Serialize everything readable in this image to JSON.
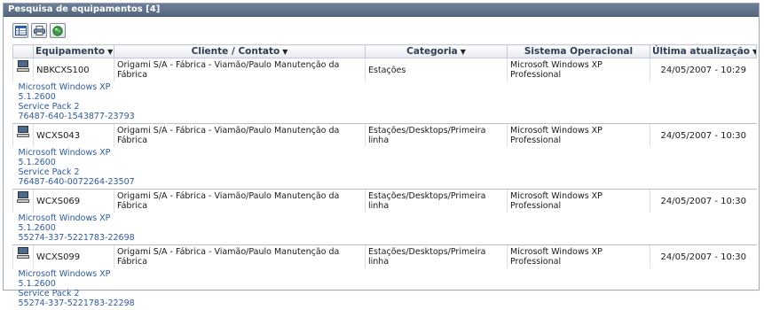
{
  "panel": {
    "title": "Pesquisa de equipamentos [4]"
  },
  "toolbar": {
    "buttons": [
      "grid-view-icon",
      "print-icon",
      "globe-icon"
    ]
  },
  "columns": [
    {
      "label": "Equipamento",
      "sortable": true
    },
    {
      "label": "Cliente / Contato",
      "sortable": true
    },
    {
      "label": "Categoria",
      "sortable": true
    },
    {
      "label": "Sistema Operacional",
      "sortable": false
    },
    {
      "label": "Última atualização",
      "sortable": true
    }
  ],
  "rows": [
    {
      "equipment": "NBKCXS100",
      "client": "Origami S/A - Fábrica - Viamão/Paulo Manutenção da Fábrica",
      "category": "Estações",
      "os": "Microsoft Windows XP Professional",
      "updated": "24/05/2007 - 10:29",
      "details": [
        "Microsoft Windows XP",
        "5.1.2600",
        "Service Pack 2",
        "76487-640-1543877-23793"
      ]
    },
    {
      "equipment": "WCXS043",
      "client": "Origami S/A - Fábrica - Viamão/Paulo Manutenção da Fábrica",
      "category": "Estações/Desktops/Primeira linha",
      "os": "Microsoft Windows XP Professional",
      "updated": "24/05/2007 - 10:30",
      "details": [
        "Microsoft Windows XP",
        "5.1.2600",
        "Service Pack 2",
        "76487-640-0072264-23507"
      ]
    },
    {
      "equipment": "WCXS069",
      "client": "Origami S/A - Fábrica - Viamão/Paulo Manutenção da Fábrica",
      "category": "Estações/Desktops/Primeira linha",
      "os": "Microsoft Windows XP Professional",
      "updated": "24/05/2007 - 10:30",
      "details": [
        "Microsoft Windows XP",
        "5.1.2600",
        "55274-337-5221783-22698"
      ]
    },
    {
      "equipment": "WCXS099",
      "client": "Origami S/A - Fábrica - Viamão/Paulo Manutenção da Fábrica",
      "category": "Estações/Desktops/Primeira linha",
      "os": "Microsoft Windows XP Professional",
      "updated": "24/05/2007 - 10:30",
      "details": [
        "Microsoft Windows XP",
        "5.1.2600",
        "Service Pack 2",
        "55274-337-5221783-22298"
      ]
    }
  ]
}
